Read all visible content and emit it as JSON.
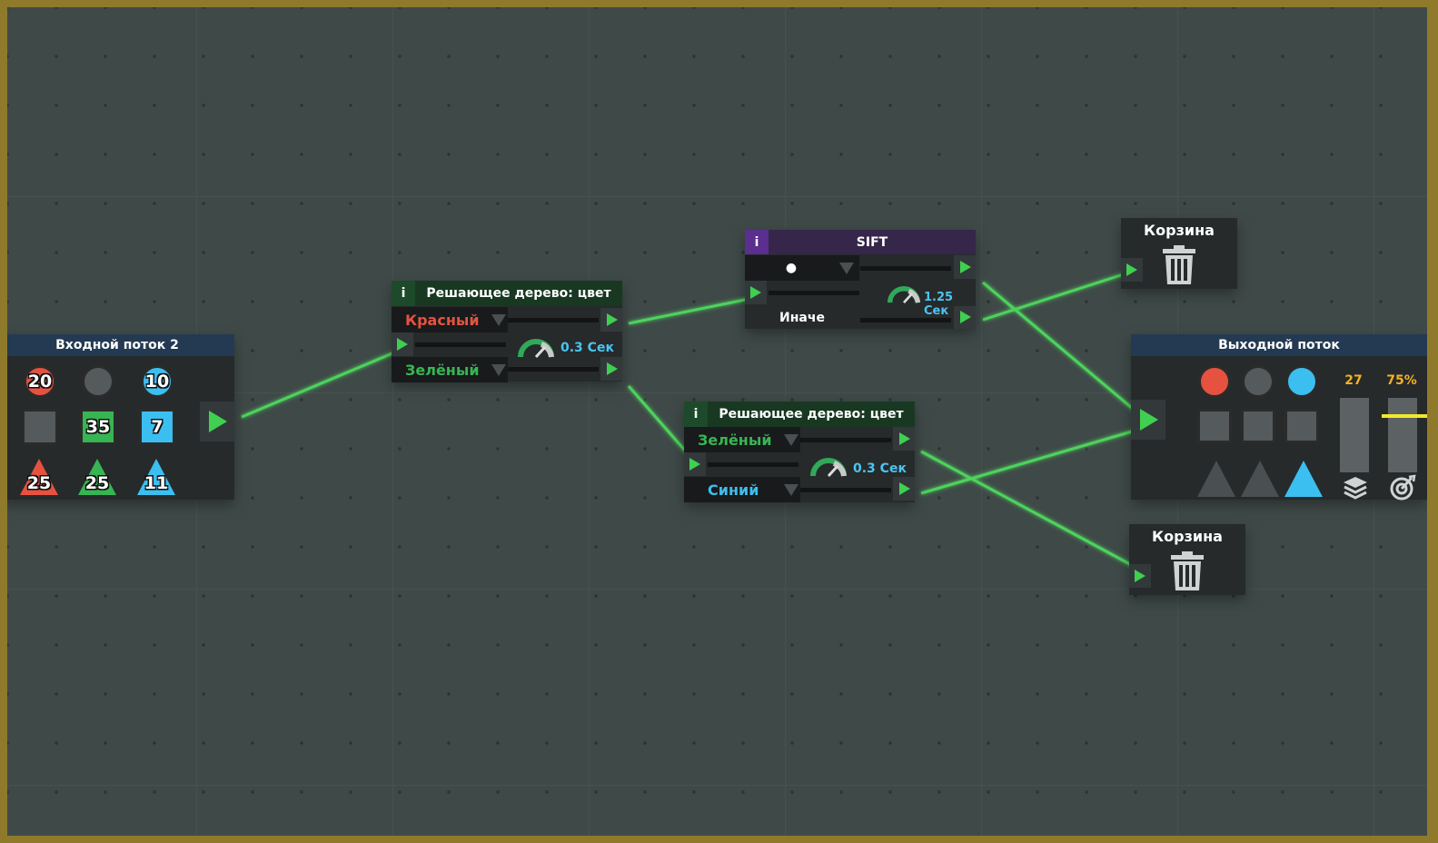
{
  "colors": {
    "red": "#e6523f",
    "green": "#37b553",
    "blue": "#3bbff0",
    "gray": "#555a5c",
    "wire": "#3fd04f",
    "accent_yellow": "#f2b324",
    "level_line": "#f5e82a"
  },
  "input_node": {
    "title": "Входной поток 2",
    "circles": [
      "20",
      "",
      "10"
    ],
    "squares": [
      "",
      "35",
      "7"
    ],
    "triangles": [
      "25",
      "25",
      "11"
    ]
  },
  "decision_tree_1": {
    "info_label": "i",
    "title": "Решающее дерево: цвет",
    "option_top": "Красный",
    "option_bottom": "Зелёный",
    "speed": "0.3 Сек"
  },
  "sift_node": {
    "info_label": "i",
    "title": "SIFT",
    "filter_symbol": "●",
    "speed": "1.25 Сек",
    "else_label": "Иначе"
  },
  "decision_tree_2": {
    "info_label": "i",
    "title": "Решающее дерево: цвет",
    "option_top": "Зелёный",
    "option_bottom": "Синий",
    "speed": "0.3 Сек"
  },
  "trash_1": {
    "title": "Корзина",
    "icon": "trash-icon"
  },
  "trash_2": {
    "title": "Корзина",
    "icon": "trash-icon"
  },
  "output_node": {
    "title": "Выходной поток",
    "count": "27",
    "percent": "75%",
    "icons": [
      "layers-icon",
      "target-icon"
    ]
  }
}
